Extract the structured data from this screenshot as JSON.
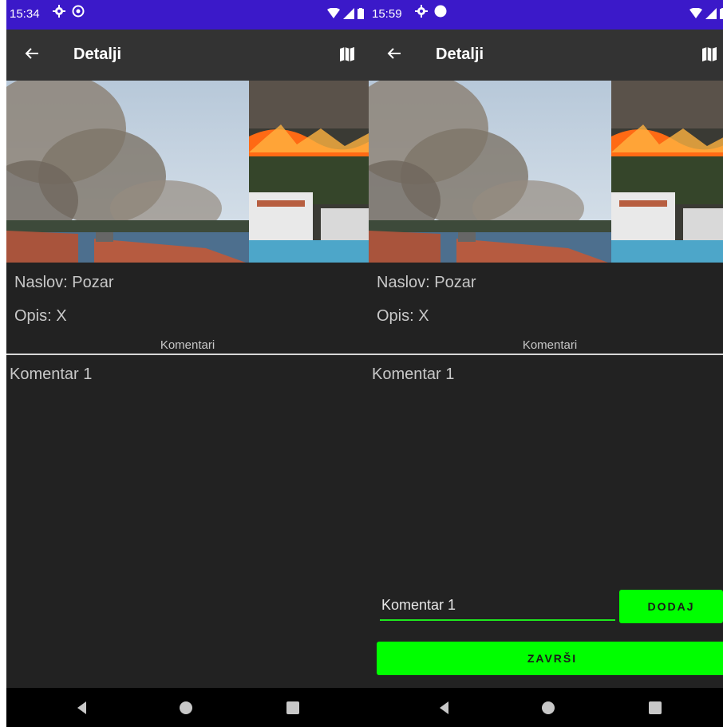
{
  "screens": [
    {
      "id": "left",
      "status": {
        "time": "15:34"
      },
      "appbar": {
        "title": "Detalji"
      },
      "details": {
        "title_label": "Naslov:",
        "title_value": "Pozar",
        "desc_label": "Opis:",
        "desc_value": "X"
      },
      "comments_label": "Komentari",
      "comments": [
        "Komentar 1"
      ]
    },
    {
      "id": "right",
      "status": {
        "time": "15:59"
      },
      "appbar": {
        "title": "Detalji"
      },
      "details": {
        "title_label": "Naslov:",
        "title_value": "Pozar",
        "desc_label": "Opis:",
        "desc_value": "X"
      },
      "comments_label": "Komentari",
      "comments": [
        "Komentar 1"
      ],
      "form": {
        "input_value": "Komentar 1",
        "add_label": "DODAJ",
        "finish_label": "ZAVRŠI"
      }
    }
  ],
  "colors": {
    "statusbar": "#3b19c9",
    "appbar": "#333333",
    "background": "#222222",
    "accent": "#00ff00",
    "text": "#c8c8c8"
  },
  "icons": [
    "back-arrow-icon",
    "map-icon",
    "gear-icon",
    "wifi-icon",
    "signal-icon",
    "battery-icon",
    "nav-back-icon",
    "nav-home-icon",
    "nav-recent-icon"
  ]
}
